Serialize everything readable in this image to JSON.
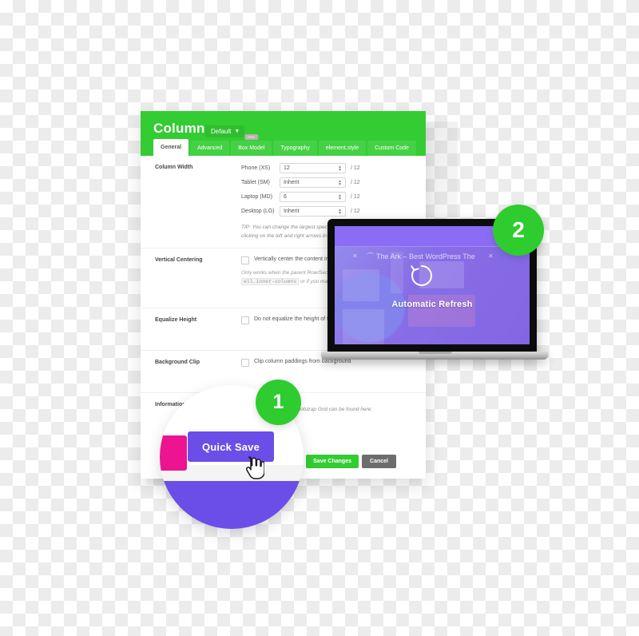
{
  "panel": {
    "title": "Column",
    "preset": {
      "label": "Default",
      "caret": "chevron-down-icon"
    },
    "tabs": [
      {
        "label": "General",
        "active": true,
        "badge": ""
      },
      {
        "label": "Advanced",
        "active": false,
        "badge": ""
      },
      {
        "label": "Box Model",
        "active": false,
        "badge": "PRO"
      },
      {
        "label": "Typography",
        "active": false,
        "badge": ""
      },
      {
        "label": "element.style",
        "active": false,
        "badge": ""
      },
      {
        "label": "Custom Code",
        "active": false,
        "badge": ""
      }
    ],
    "rows": {
      "column_width": {
        "label": "Column Width",
        "fields": [
          {
            "name": "Phone (XS)",
            "value": "12",
            "suffix": "/ 12"
          },
          {
            "name": "Tablet (SM)",
            "value": "Inherit",
            "suffix": "/ 12"
          },
          {
            "name": "Laptop (MD)",
            "value": "6",
            "suffix": "/ 12"
          },
          {
            "name": "Desktop (LG)",
            "value": "Inherit",
            "suffix": "/ 12"
          }
        ],
        "tip_line1": "TIP: You can change the largest specified column width by",
        "tip_line2": "clicking on the left and right arrows in the Column"
      },
      "vertical_centering": {
        "label": "Vertical Centering",
        "checkbox_label": "Vertically center the content inside this column",
        "note_line1": "Only works when the parent Row/Section element has",
        "note_code": "ell.inner-columns",
        "note_line2": "or if you manually set a fixed height"
      },
      "equalize_height": {
        "label": "Equalize Height",
        "checkbox_label": "Do not equalize the height of this Column"
      },
      "background_clip": {
        "label": "Background Clip",
        "checkbox_label": "Clip column paddings from background"
      },
      "information": {
        "label": "Information",
        "text": "More details about the Bootstrap Grid can be found here:"
      }
    },
    "footer": {
      "save_label": "Save Changes",
      "cancel_label": "Cancel"
    }
  },
  "magnifier": {
    "quick_save_label": "Quick Save",
    "pink_tab_glyph": "❯",
    "cursor": "hand-pointer-cursor"
  },
  "laptop": {
    "browser_tab_title": "The Ark – Best WordPress The",
    "close_glyph": "✕",
    "refresh_label": "Automatic Refresh",
    "refresh_icon": "circular-refresh-arrow-icon"
  },
  "steps": {
    "one": "1",
    "two": "2"
  },
  "colors": {
    "green": "#33cc33",
    "badge_green": "#2ecc2e",
    "purple": "#6b4ee8",
    "screen_purple": "#7b5cf0",
    "pink": "#ec1491",
    "gray_button": "#6d6d6d"
  }
}
